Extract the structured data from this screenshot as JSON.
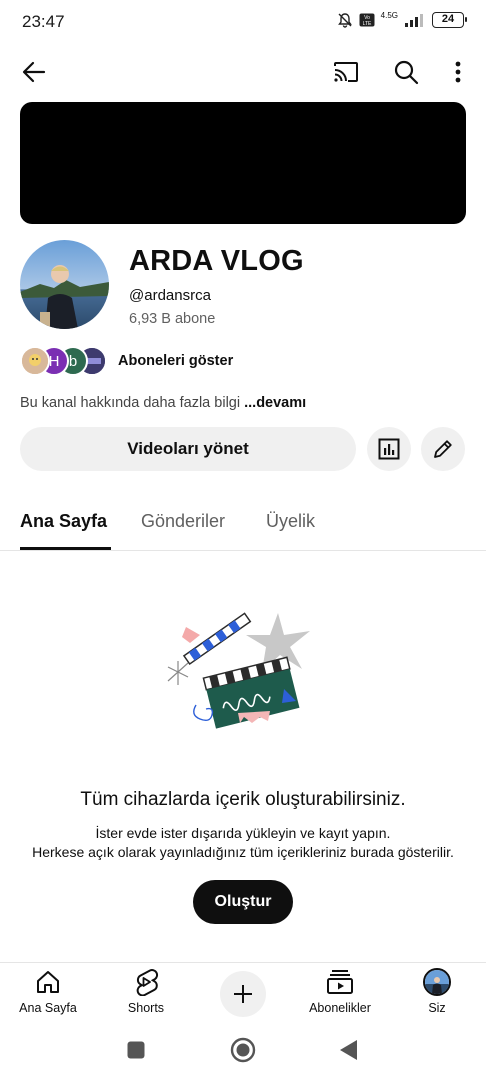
{
  "status_bar": {
    "time": "23:47",
    "network": "4.5G",
    "volte": "Vo LTE",
    "battery": "24"
  },
  "top_bar": {
    "icons": [
      "back-arrow-icon",
      "cast-icon",
      "search-icon",
      "more-vert-icon"
    ]
  },
  "channel": {
    "name": "ARDA VLOG",
    "handle": "@ardansrca",
    "subscribers": "6,93 B abone",
    "show_subscribers": "Aboneleri göster",
    "subscriber_avatars": [
      {
        "letter": "",
        "color": "#d8b89a"
      },
      {
        "letter": "H",
        "color": "#7b2fb3"
      },
      {
        "letter": "b",
        "color": "#2e6a50"
      },
      {
        "letter": "",
        "color": "#3d3a6e"
      }
    ],
    "about": "Bu kanal hakkında daha fazla bilgi",
    "about_more": "...devamı"
  },
  "actions": {
    "manage_videos": "Videoları yönet",
    "analytics_icon": "analytics-icon",
    "edit_icon": "pencil-icon"
  },
  "tabs": [
    {
      "label": "Ana Sayfa",
      "active": true
    },
    {
      "label": "Gönderiler",
      "active": false
    },
    {
      "label": "Üyelik",
      "active": false
    }
  ],
  "empty_state": {
    "title": "Tüm cihazlarda içerik oluşturabilirsiniz.",
    "line1": "İster evde ister dışarıda yükleyin ve kayıt yapın.",
    "line2": "Herkese açık olarak yayınladığınız tüm içerikleriniz burada gösterilir.",
    "button": "Oluştur"
  },
  "bottom_nav": [
    {
      "label": "Ana Sayfa",
      "icon": "home-icon"
    },
    {
      "label": "Shorts",
      "icon": "shorts-icon"
    },
    {
      "label": "",
      "icon": "plus-icon"
    },
    {
      "label": "Abonelikler",
      "icon": "subscriptions-icon"
    },
    {
      "label": "Siz",
      "icon": "avatar"
    }
  ],
  "colors": {
    "accent": "#0f0f0f",
    "secondary_text": "#606060",
    "chip_bg": "#f0f0f0"
  }
}
